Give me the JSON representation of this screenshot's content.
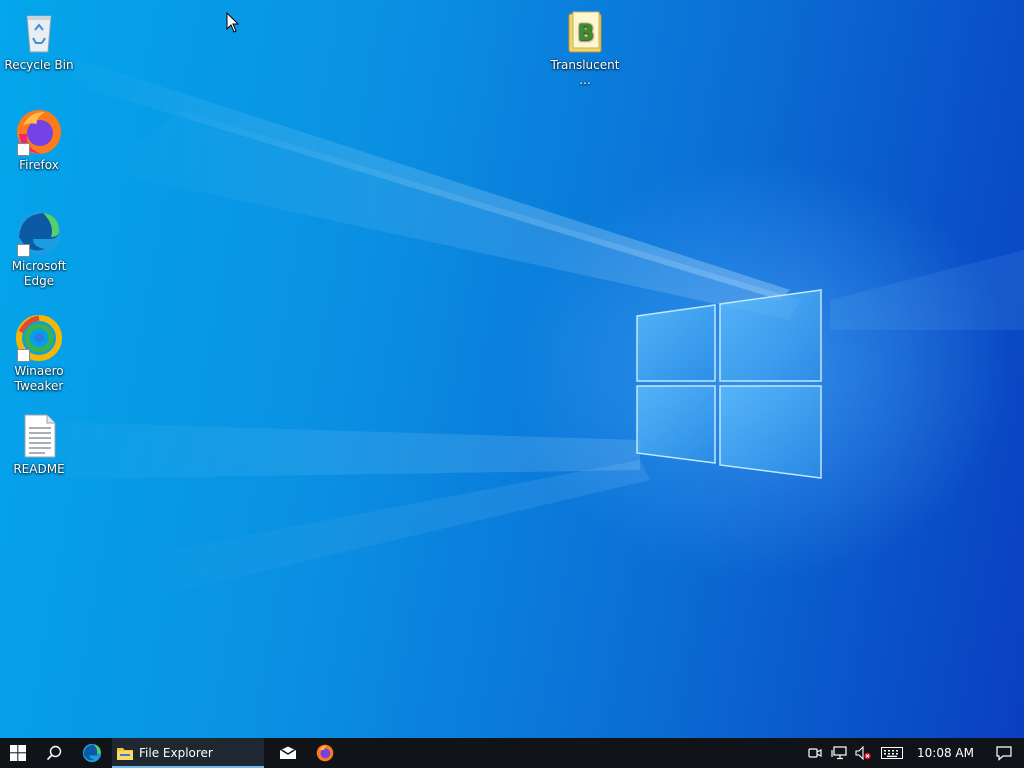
{
  "desktop": {
    "icons": [
      {
        "label": "Recycle Bin",
        "icon": "recycle-bin-icon"
      },
      {
        "label": "Firefox",
        "icon": "firefox-icon"
      },
      {
        "label": "Microsoft Edge",
        "icon": "edge-icon"
      },
      {
        "label": "Winaero Tweaker",
        "icon": "winaero-tweaker-icon"
      },
      {
        "label": "README",
        "icon": "text-document-icon"
      },
      {
        "label": "Translucent...",
        "icon": "translucenttb-icon"
      }
    ],
    "colors": {
      "wallpaper_light": "#04a6ec",
      "wallpaper_dark": "#0a3fc0"
    }
  },
  "taskbar": {
    "start": "windows-start-icon",
    "search": "search-icon",
    "pinned": [
      {
        "name": "edge",
        "icon": "edge-icon"
      },
      {
        "name": "file-explorer",
        "icon": "folder-icon",
        "label": "File Explorer"
      },
      {
        "name": "mail",
        "icon": "mail-icon"
      },
      {
        "name": "firefox",
        "icon": "firefox-icon"
      }
    ],
    "tray": {
      "icons": [
        "meet-now-icon",
        "network-icon",
        "volume-muted-icon",
        "keyboard-icon"
      ],
      "clock": "10:08 AM",
      "notification": "action-center-icon"
    },
    "colors": {
      "background": "#101418",
      "active_indicator": "#76b9ed"
    }
  }
}
